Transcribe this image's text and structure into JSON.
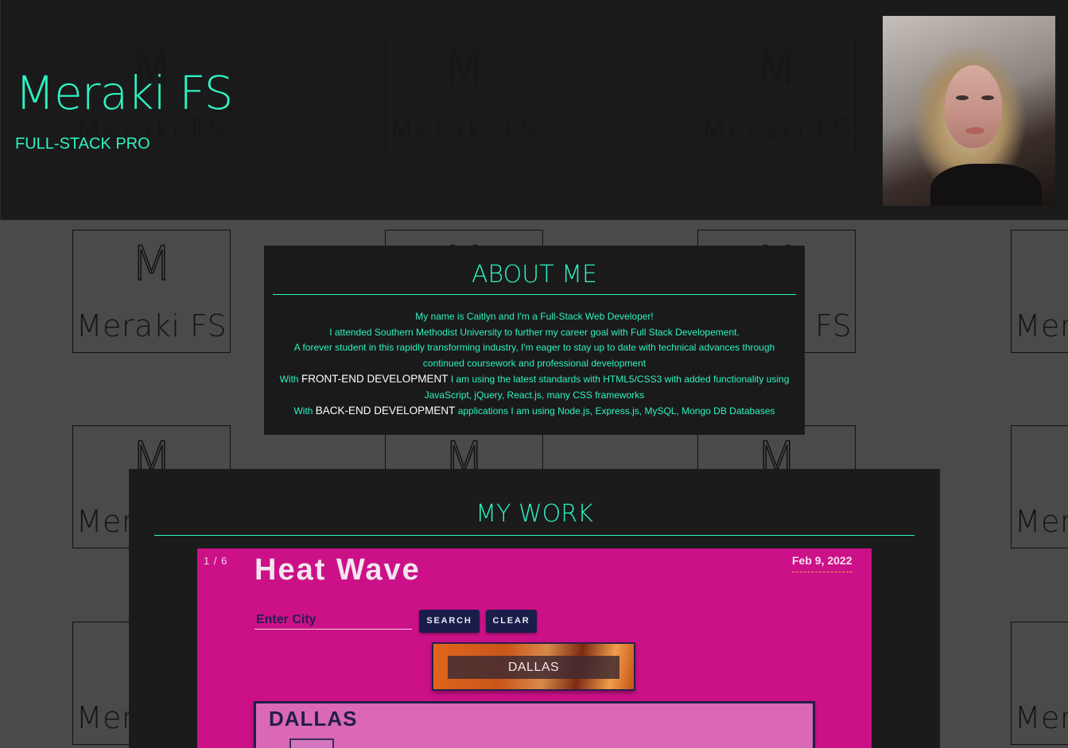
{
  "header": {
    "brand": "Meraki FS",
    "tagline": "FULL-STACK PRO"
  },
  "watermark": {
    "monogram": "M",
    "text": "Meraki FS"
  },
  "about": {
    "title": "ABOUT ME",
    "line1": "My name is Caitlyn and I'm a Full-Stack Web Developer!",
    "line2": "I attended Southern Methodist University to further my career goal with Full Stack Developement.",
    "line3": "A forever student in this rapidly transforming industry, I'm eager to stay up to date with technical advances through continued coursework and professional development",
    "line4_prefix": "With",
    "line4_highlight": "FRONT-END DEVELOPMENT",
    "line4_suffix": "I am using the latest standards with HTML5/CSS3 with added functionality using JavaScript, jQuery, React.js, many CSS frameworks",
    "line5_prefix": "With",
    "line5_highlight": "BACK-END DEVELOPMENT",
    "line5_suffix": "applications I am using Node.js, Express.js, MySQL, Mongo DB Databases"
  },
  "work": {
    "title": "MY WORK",
    "slide": {
      "counter": "1 / 6",
      "app_title": "Heat Wave",
      "date": "Feb 9, 2022",
      "city_placeholder": "Enter City",
      "search_label": "SEARCH",
      "clear_label": "CLEAR",
      "history_item": "DALLAS",
      "forecast_city": "DALLAS"
    }
  },
  "colors": {
    "accent": "#2ef2c2",
    "header_bg": "#161616",
    "page_bg": "#4a4a4a",
    "slide_bg": "#cc1188",
    "button_bg": "#1a1d4a"
  }
}
